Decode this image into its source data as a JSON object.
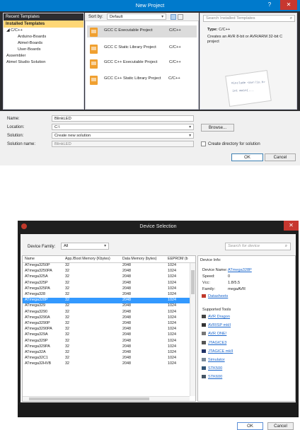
{
  "new_project": {
    "title": "New Project",
    "help_glyph": "?",
    "close_glyph": "✕",
    "tree": {
      "recent": "Recent Templates",
      "installed": "Installed Templates",
      "items": [
        {
          "label": "C/C++",
          "prefix": "◢ "
        },
        {
          "label": "Arduino-Boards"
        },
        {
          "label": "Atmel-Boards"
        },
        {
          "label": "User-Boards"
        },
        {
          "label": "Assembler"
        },
        {
          "label": "Atmel Studio Solution"
        }
      ]
    },
    "sortbar": {
      "label": "Sort by:",
      "value": "Default"
    },
    "search_placeholder": "Search Installed Templates",
    "templates": [
      {
        "name": "GCC C Executable Project",
        "lang": "C/C++",
        "selected": true
      },
      {
        "name": "GCC C Static Library Project",
        "lang": "C/C++"
      },
      {
        "name": "GCC C++ Executable Project",
        "lang": "C/C++"
      },
      {
        "name": "GCC C++ Static Library Project",
        "lang": "C/C++"
      }
    ],
    "detail": {
      "type_label": "Type:",
      "type_value": "C/C++",
      "description": "Creates an AVR 8-bit or AVR/ARM 32-bit C project",
      "code_snippet_line1": "#include <avr/io.h>",
      "code_snippet_line2": "int main(..."
    },
    "form": {
      "name_label": "Name:",
      "name_value": "BlinkLED",
      "location_label": "Location:",
      "location_value": "C:\\",
      "solution_label": "Solution:",
      "solution_value": "Create new solution",
      "solution_name_label": "Solution name:",
      "solution_name_value": "BlinkLED",
      "browse": "Browse...",
      "create_dir": "Create directory for solution",
      "ok": "OK",
      "cancel": "Cancel"
    }
  },
  "device_selection": {
    "title": "Device Selection",
    "close_glyph": "✕",
    "family_label": "Device Family:",
    "family_value": "All",
    "search_placeholder": "Search for device",
    "columns": [
      "Name",
      "App./Boot Memory (Kbytes)",
      "Data Memory (bytes)",
      "EEPROM (b"
    ],
    "rows": [
      [
        "ATmega3250P",
        "32",
        "2048",
        "1024"
      ],
      [
        "ATmega3250PA",
        "32",
        "2048",
        "1024"
      ],
      [
        "ATmega325A",
        "32",
        "2048",
        "1024"
      ],
      [
        "ATmega325P",
        "32",
        "2048",
        "1024"
      ],
      [
        "ATmega325PA",
        "32",
        "2048",
        "1024"
      ],
      [
        "ATmega328",
        "32",
        "2048",
        "1024"
      ],
      [
        "ATmega328P",
        "32",
        "2048",
        "1024"
      ],
      [
        "ATmega329",
        "32",
        "2048",
        "1024"
      ],
      [
        "ATmega3290",
        "32",
        "2048",
        "1024"
      ],
      [
        "ATmega3290A",
        "32",
        "2048",
        "1024"
      ],
      [
        "ATmega3290P",
        "32",
        "2048",
        "1024"
      ],
      [
        "ATmega3290PA",
        "32",
        "2048",
        "1024"
      ],
      [
        "ATmega329A",
        "32",
        "2048",
        "1024"
      ],
      [
        "ATmega329P",
        "32",
        "2048",
        "1024"
      ],
      [
        "ATmega329PA",
        "32",
        "2048",
        "1024"
      ],
      [
        "ATmega32A",
        "32",
        "2048",
        "1024"
      ],
      [
        "ATmega32C1",
        "32",
        "2048",
        "1024"
      ],
      [
        "ATmega32HVB",
        "32",
        "2048",
        "1024"
      ]
    ],
    "selected_index": 6,
    "info": {
      "header": "Device Info:",
      "device_name_label": "Device Name:",
      "device_name_value": "ATmega328P",
      "speed_label": "Speed:",
      "speed_value": "0",
      "vcc_label": "Vcc:",
      "vcc_value": "1.8/5.5",
      "family_label": "Family:",
      "family_value": "megaAVR",
      "datasheets": "Datasheets",
      "tools_header": "Supported Tools",
      "tools": [
        {
          "name": "AVR Dragon",
          "icon": "dragon-icon",
          "color": "#444444"
        },
        {
          "name": "AVRISP mkII",
          "icon": "isp-icon",
          "color": "#333333"
        },
        {
          "name": "AVR ONE!",
          "icon": "one-icon",
          "color": "#777777"
        },
        {
          "name": "JTAGICE3",
          "icon": "jtag3-icon",
          "color": "#555555"
        },
        {
          "name": "JTAGICE mkII",
          "icon": "jtag2-icon",
          "color": "#223366"
        },
        {
          "name": "Simulator",
          "icon": "simulator-icon",
          "color": "#7a8a9a"
        },
        {
          "name": "STK500",
          "icon": "stk500-icon",
          "color": "#335577"
        },
        {
          "name": "STK600",
          "icon": "stk600-icon",
          "color": "#445566"
        }
      ]
    },
    "ok": "OK",
    "cancel": "Cancel"
  }
}
